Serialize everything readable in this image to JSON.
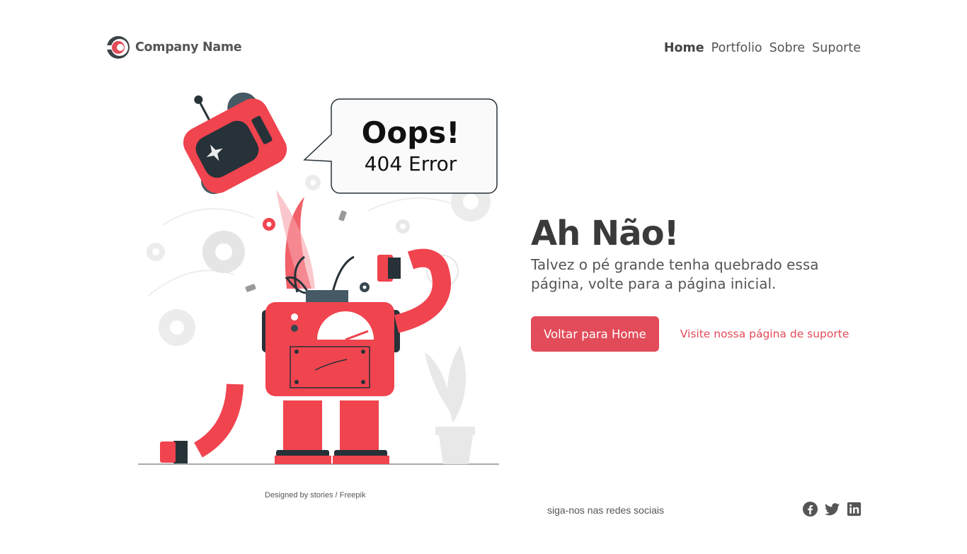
{
  "header": {
    "brand_name": "Company Name",
    "nav": [
      {
        "label": "Home",
        "active": true
      },
      {
        "label": "Portfolio",
        "active": false
      },
      {
        "label": "Sobre",
        "active": false
      },
      {
        "label": "Suporte",
        "active": false
      }
    ]
  },
  "illustration": {
    "bubble_title": "Oops!",
    "bubble_subtitle": "404 Error",
    "credit": "Designed by stories / Freepik"
  },
  "main": {
    "title": "Ah Não!",
    "subtitle": "Talvez o pé grande tenha quebrado essa página, volte para a página inicial.",
    "home_button_label": "Voltar para Home",
    "support_link_label": "Visite nossa página de suporte"
  },
  "footer": {
    "social_text": "siga-nos nas redes sociais",
    "social_icons": [
      "facebook-icon",
      "twitter-icon",
      "linkedin-icon"
    ]
  },
  "colors": {
    "accent": "#e24b59",
    "robot_red": "#f0444f",
    "dark": "#263238",
    "text": "#555555"
  }
}
